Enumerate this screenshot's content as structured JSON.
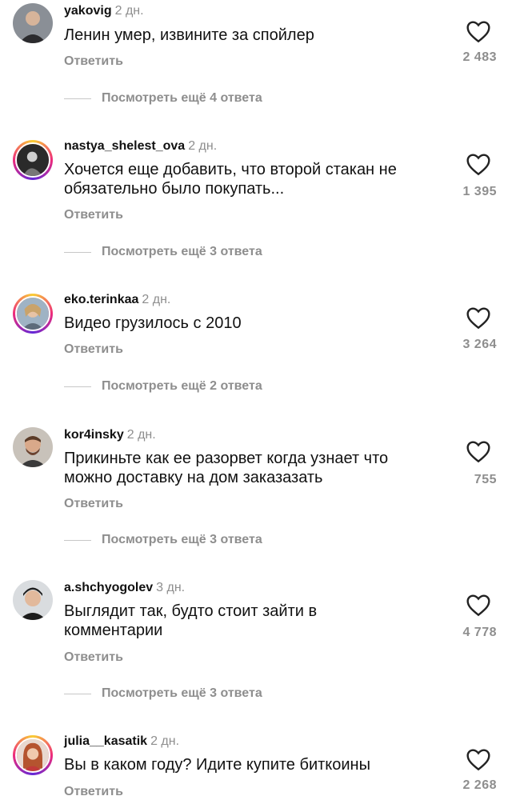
{
  "comments": [
    {
      "username": "yakovig",
      "time": "2 дн.",
      "text": "Ленин умер, извините за спойлер",
      "reply_label": "Ответить",
      "likes": "2 483",
      "more_replies": "Посмотреть ещё 4 ответа"
    },
    {
      "username": "nastya_shelest_ova",
      "time": "2 дн.",
      "text": "Хочется еще добавить, что второй стакан не обязательно было покупать...",
      "reply_label": "Ответить",
      "likes": "1 395",
      "more_replies": "Посмотреть ещё 3 ответа"
    },
    {
      "username": "eko.terinkaa",
      "time": "2 дн.",
      "text": "Видео грузилось с 2010",
      "reply_label": "Ответить",
      "likes": "3 264",
      "more_replies": "Посмотреть ещё 2 ответа"
    },
    {
      "username": "kor4insky",
      "time": "2 дн.",
      "text": "Прикиньте как ее разорвет когда узнает что можно доставку на дом заказазать",
      "reply_label": "Ответить",
      "likes": "755",
      "more_replies": "Посмотреть ещё 3 ответа"
    },
    {
      "username": "a.shchyogolev",
      "time": "3 дн.",
      "text": "Выглядит так, будто стоит зайти в комментарии",
      "reply_label": "Ответить",
      "likes": "4 778",
      "more_replies": "Посмотреть ещё 3 ответа"
    },
    {
      "username": "julia__kasatik",
      "time": "2 дн.",
      "text": "Вы в каком году? Идите купите биткоины",
      "reply_label": "Ответить",
      "likes": "2 268"
    }
  ],
  "icons": {
    "like": "heart-outline-icon",
    "thread_line": "reply-thread-line"
  },
  "colors": {
    "text": "#111111",
    "secondary": "#8e8e8e",
    "story_ring": [
      "#f9ce34",
      "#ee2a7b",
      "#6228d7"
    ]
  }
}
